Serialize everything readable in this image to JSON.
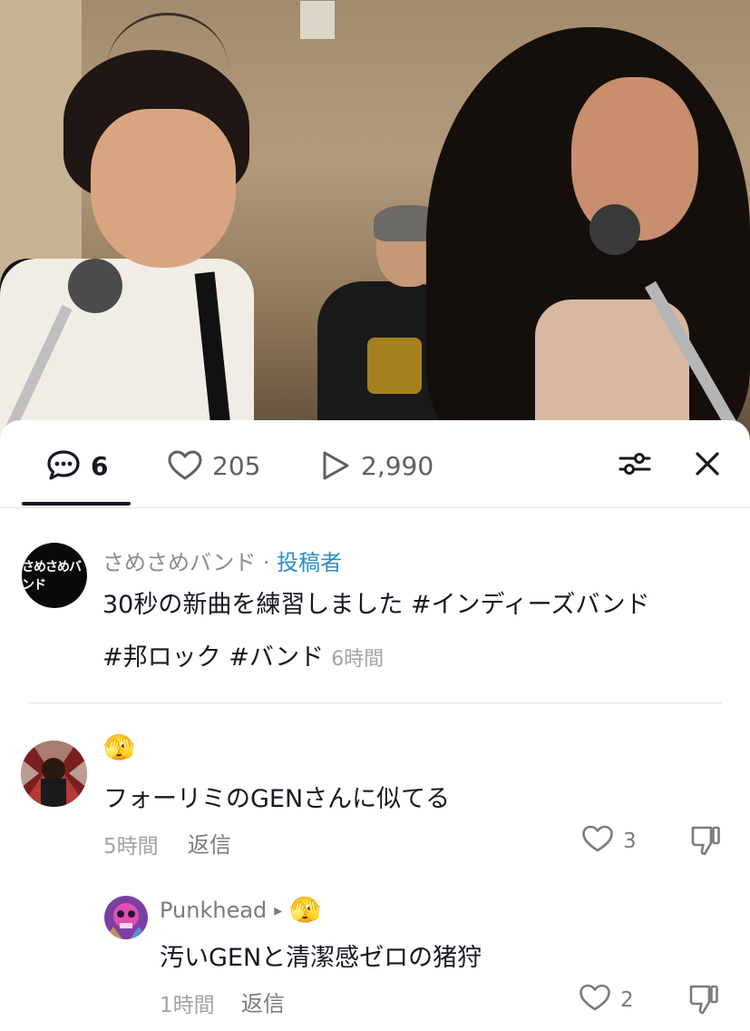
{
  "tabs": {
    "comments_count": "6",
    "likes_count": "205",
    "views_count": "2,990"
  },
  "caption": {
    "avatar_text": "さめさめバンド",
    "author": "さめさめバンド",
    "separator": " · ",
    "author_tag": "投稿者",
    "line1": "30秒の新曲を練習しました #インディーズバンド",
    "line2": "#邦ロック #バンド",
    "time": "6時間"
  },
  "comments": [
    {
      "emoji": "🫣",
      "text": "フォーリミのGENさんに似てる",
      "time": "5時間",
      "reply_label": "返信",
      "likes": "3"
    },
    {
      "username": "Punkhead",
      "reply_arrow": "▸",
      "emoji": "🫣",
      "text": "汚いGENと清潔感ゼロの猪狩",
      "time": "1時間",
      "reply_label": "返信",
      "likes": "2"
    }
  ],
  "colors": {
    "text": "#161823",
    "muted": "#a2a3a8",
    "accent": "#2b8ec7",
    "divider": "#e3e3e4"
  },
  "icons": {
    "comments": "comment-bubble-icon",
    "likes": "heart-outline-icon",
    "views": "play-outline-icon",
    "filter": "sliders-icon",
    "close": "close-icon",
    "like": "heart-outline-icon",
    "dislike": "thumbs-down-icon"
  }
}
